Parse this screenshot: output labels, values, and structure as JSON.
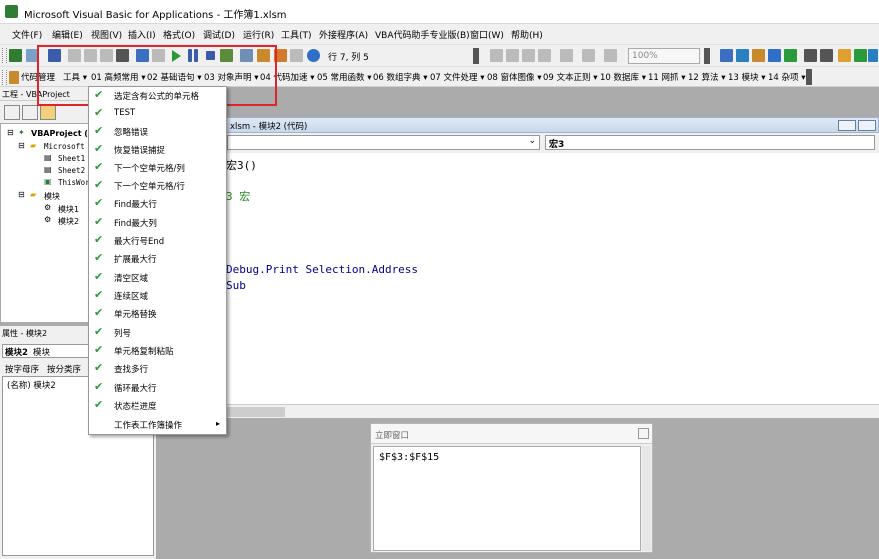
{
  "window": {
    "title": "Microsoft Visual Basic for Applications - 工作簿1.xlsm"
  },
  "menubar": [
    "文件(F)",
    "编辑(E)",
    "视图(V)",
    "插入(I)",
    "格式(O)",
    "调试(D)",
    "运行(R)",
    "工具(T)",
    "外接程序(A)",
    "VBA代码助手专业版(B)",
    "窗口(W)",
    "帮助(H)"
  ],
  "toolbar": {
    "position": "行 7, 列 5",
    "zoom": "100%"
  },
  "toolbar2": {
    "code_manage": "代码管理",
    "tools": "工具",
    "items": [
      "01 高频常用",
      "02 基础语句",
      "03 对象声明",
      "04 代码加速",
      "05 常用函数",
      "06 数组字典",
      "07 文件处理",
      "08 窗体图像",
      "09 文本正则",
      "10 数据库",
      "11 网抓",
      "12 算法",
      "13 模块",
      "14 杂项"
    ]
  },
  "project": {
    "pane_title": "工程 - VBAProject",
    "tree": {
      "root": "VBAProject (",
      "excel_objects": "Microsoft E",
      "sheet1": "Sheet1",
      "sheet2": "Sheet2",
      "workbook": "ThisWork",
      "modules": "模块",
      "module1": "模块1",
      "module2": "模块2"
    }
  },
  "properties": {
    "pane_title": "属性 - 模块2",
    "object_name": "模块2",
    "object_type": "模块",
    "tab_alpha": "按字母序",
    "tab_category": "按分类序",
    "name_row": "(名称) 模块2"
  },
  "code_window": {
    "title": "xlsm - 模块2 (代码)",
    "proc_combo": "宏3",
    "lines": {
      "l1": "宏3()",
      "l2": "3 宏",
      "l3": "Debug.Print Selection.Address",
      "l4": "Sub"
    }
  },
  "immediate": {
    "title": "立即窗口",
    "output": "$F$3:$F$15"
  },
  "dropdown": {
    "items": [
      "选定含有公式的单元格",
      "TEST",
      "忽略错误",
      "恢复错误捕捉",
      "下一个空单元格/列",
      "下一个空单元格/行",
      "Find最大行",
      "Find最大列",
      "最大行号End",
      "扩展最大行",
      "清空区域",
      "连续区域",
      "单元格替换",
      "列号",
      "单元格复制粘贴",
      "查找多行",
      "循环最大行",
      "状态栏进度"
    ],
    "submenu": "工作表工作簿操作",
    "check_color": "#2a9a3a"
  },
  "colors": {
    "highlight_box": "#e0252a",
    "keyword": "#00008b",
    "comment": "#228b22"
  }
}
